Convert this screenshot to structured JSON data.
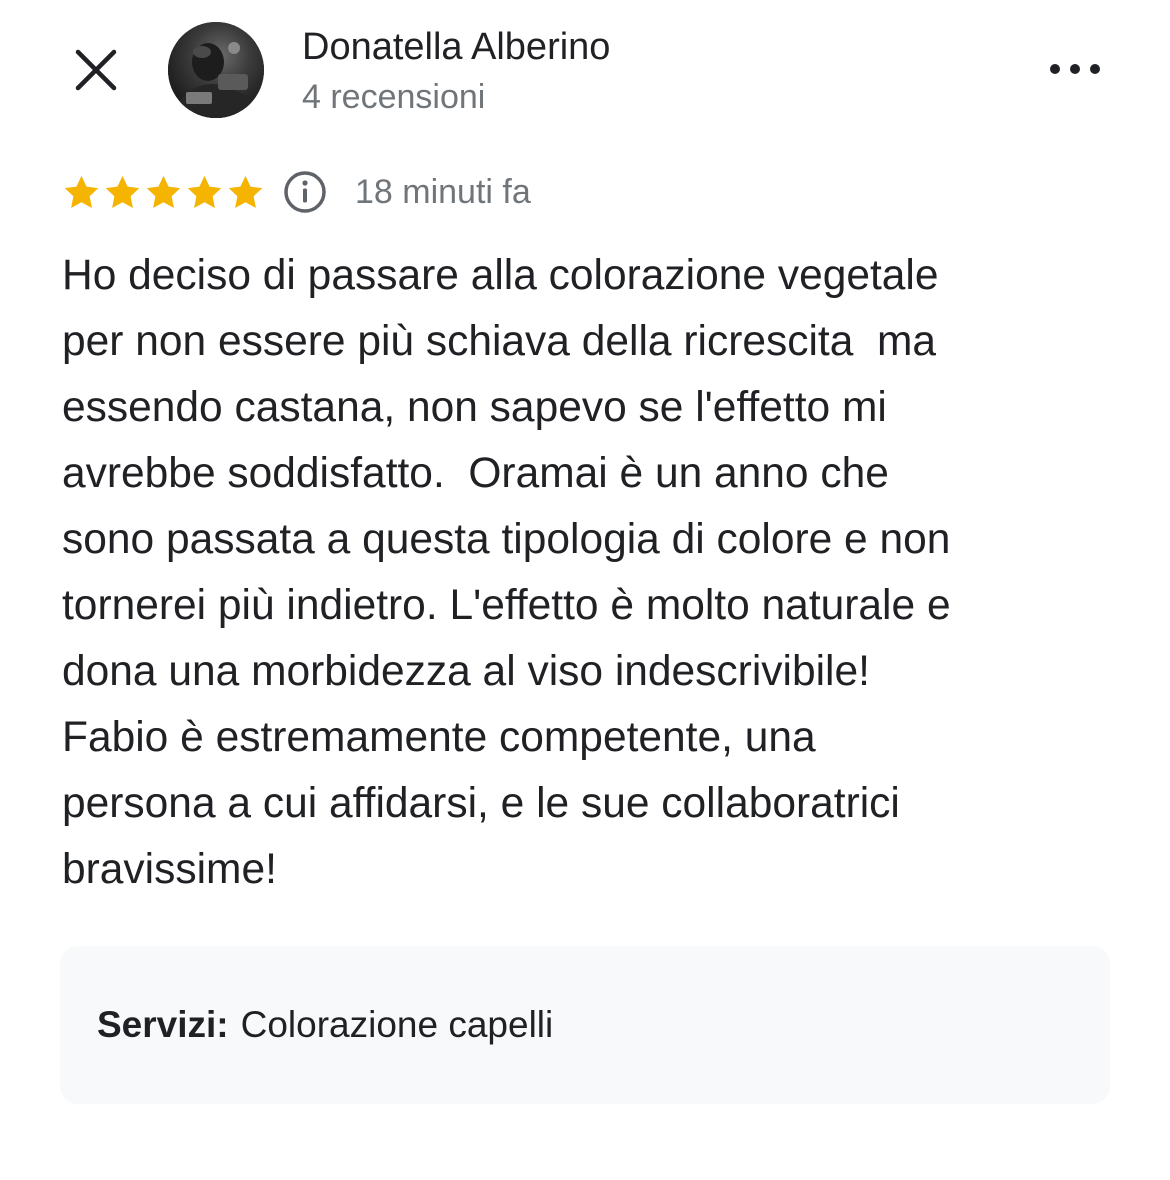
{
  "header": {
    "close_icon": "close-icon",
    "author_name": "Donatella Alberino",
    "review_count": "4 recensioni",
    "more_icon": "more-horizontal-icon"
  },
  "review": {
    "rating": 5,
    "max_rating": 5,
    "star_color": "#f4b400",
    "info_icon": "info-icon",
    "time": "18 minuti fa",
    "text_lines": [
      "Ho deciso di passare alla colorazione vegetale",
      "per non essere più schiava della ricrescita  ma",
      "essendo castana, non sapevo se l'effetto mi",
      "avrebbe soddisfatto.  Oramai è un anno che",
      "sono passata a questa tipologia di colore e non",
      "tornerei più indietro. L'effetto è molto naturale e",
      "dona una morbidezza al viso indescrivibile!",
      "Fabio è estremamente competente, una",
      "persona a cui affidarsi, e le sue collaboratrici",
      "bravissime!"
    ]
  },
  "services": {
    "label": "Servizi:",
    "value": "Colorazione capelli"
  }
}
